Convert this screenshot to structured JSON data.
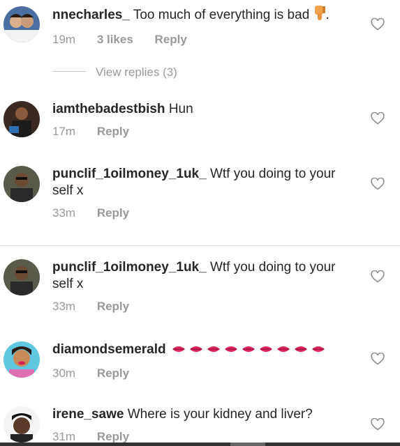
{
  "comments": [
    {
      "username": "nnecharles_",
      "text": "Too much of everything is bad",
      "emoji": "thumbs-down",
      "trail": ".",
      "time": "19m",
      "likes": "3 likes",
      "reply": "Reply"
    },
    {
      "username": "iamthebadestbish",
      "text": "Hun",
      "time": "17m",
      "reply": "Reply"
    },
    {
      "username": "punclif_1oilmoney_1uk_",
      "text": "Wtf you doing to your self x",
      "time": "33m",
      "reply": "Reply"
    },
    {
      "username": "punclif_1oilmoney_1uk_",
      "text": "Wtf you doing to your self x",
      "time": "33m",
      "reply": "Reply"
    },
    {
      "username": "diamondsemerald",
      "text": "",
      "emoji": "lips x9",
      "time": "30m",
      "reply": "Reply"
    },
    {
      "username": "irene_sawe",
      "text": "Where is your kidney and liver?",
      "time": "31m",
      "reply": "Reply"
    }
  ],
  "view_replies": "View replies (3)",
  "icons": {
    "like": "heart-icon",
    "emoji_thumb": "thumbs-down-icon",
    "emoji_lips": "lips-icon"
  },
  "colors": {
    "text": "#262626",
    "meta": "#999999",
    "divider": "#dbdbdb"
  }
}
